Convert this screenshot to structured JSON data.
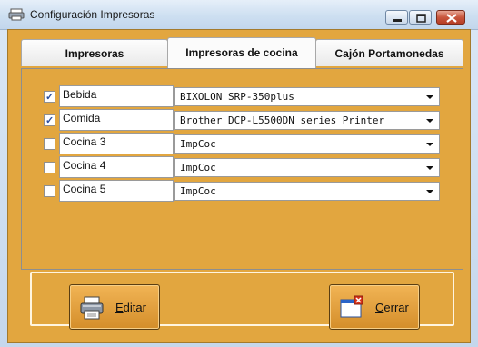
{
  "window": {
    "title": "Configuración Impresoras"
  },
  "tabs": [
    {
      "label": "Impresoras"
    },
    {
      "label": "Impresoras de cocina"
    },
    {
      "label": "Cajón Portamonedas"
    }
  ],
  "rows": [
    {
      "checked": true,
      "name": "Bebida",
      "printer": "BIXOLON SRP-350plus"
    },
    {
      "checked": true,
      "name": "Comida",
      "printer": "Brother DCP-L5500DN series Printer"
    },
    {
      "checked": false,
      "name": "Cocina 3",
      "printer": "ImpCoc"
    },
    {
      "checked": false,
      "name": "Cocina 4",
      "printer": "ImpCoc"
    },
    {
      "checked": false,
      "name": "Cocina 5",
      "printer": "ImpCoc"
    }
  ],
  "buttons": {
    "edit": {
      "label_first": "E",
      "label_rest": "ditar",
      "icon": "printer-icon"
    },
    "close": {
      "label_first": "C",
      "label_rest": "errar",
      "icon": "close-window-icon"
    }
  },
  "colors": {
    "panel": "#e2a63f",
    "titlebar": "#cddff1",
    "close_button": "#c9573e"
  }
}
